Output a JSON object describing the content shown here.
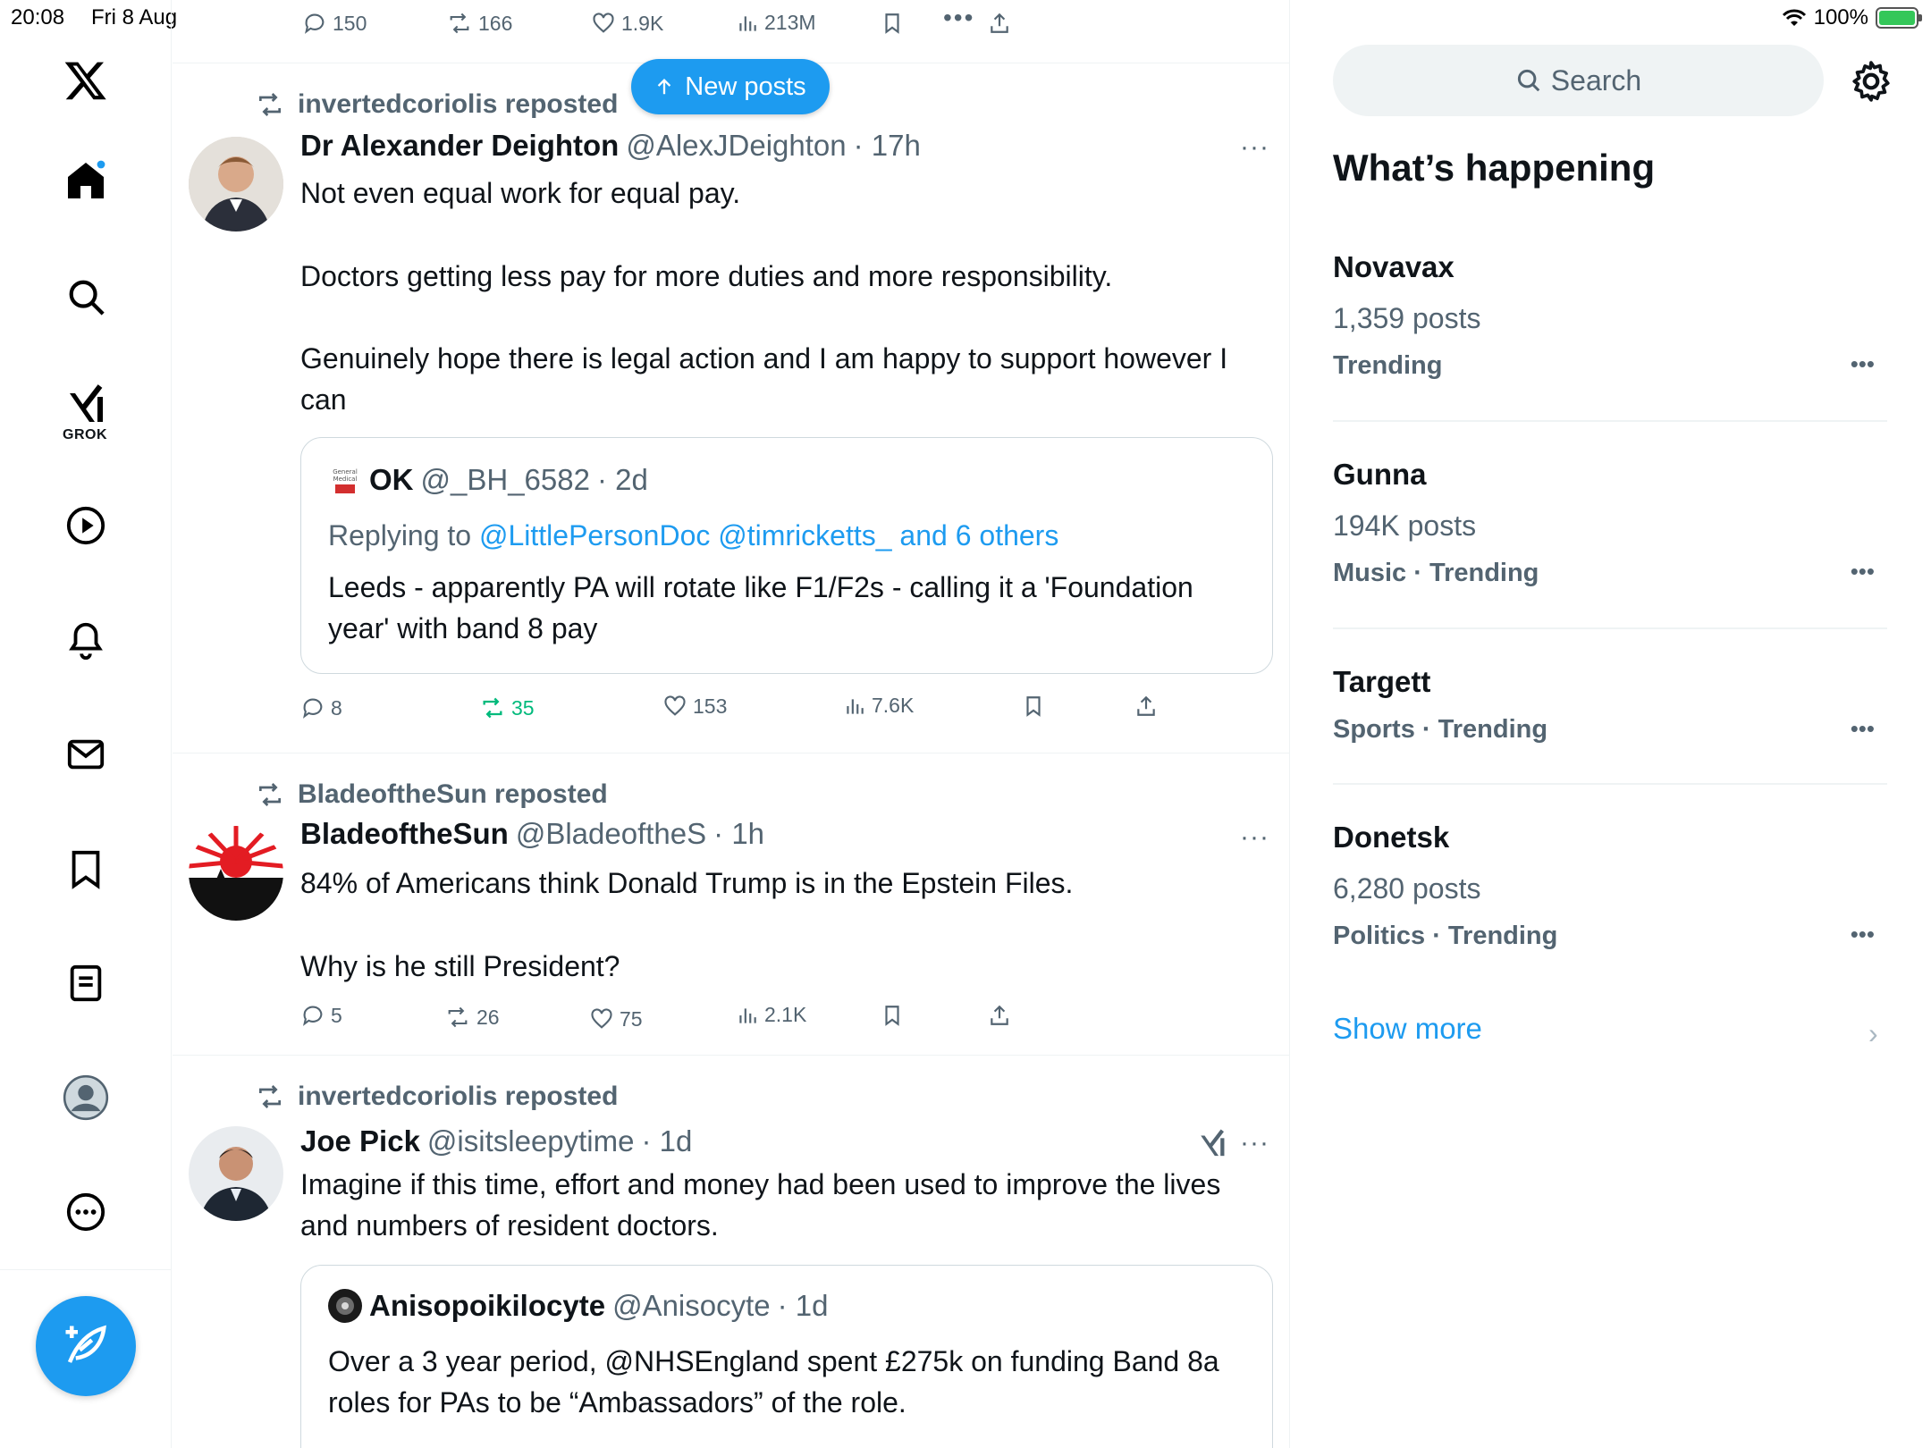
{
  "status_bar": {
    "time": "20:08",
    "date": "Fri 8 Aug",
    "battery": "100%"
  },
  "nav": {
    "grok_label": "GROK"
  },
  "top_actions": {
    "replies": "150",
    "reposts": "166",
    "likes": "1.9K",
    "views": "213M"
  },
  "new_posts_label": "New posts",
  "posts": [
    {
      "reposted_by": "invertedcoriolis reposted",
      "name": "Dr Alexander Deighton",
      "handle": "@AlexJDeighton",
      "time": "· 17h",
      "lines": [
        "Not even equal work for equal pay.",
        "Doctors getting less pay for more duties and more responsibility.",
        "Genuinely hope there is legal action and I am happy to support however I can"
      ],
      "quote": {
        "name": "OK",
        "handle": "@_BH_6582",
        "time": "· 2d",
        "replying_prefix": "Replying to",
        "replying_to": "@LittlePersonDoc @timricketts_ and 6 others",
        "text": "Leeds - apparently PA will rotate like F1/F2s - calling it a 'Foundation year' with band 8 pay"
      },
      "actions": {
        "replies": "8",
        "reposts": "35",
        "likes": "153",
        "views": "7.6K"
      }
    },
    {
      "reposted_by": "BladeoftheSun reposted",
      "name": "BladeoftheSun",
      "handle": "@BladeoftheS",
      "time": "· 1h",
      "lines": [
        "84% of Americans think Donald Trump is in the Epstein Files.",
        "Why is he still President?"
      ],
      "actions": {
        "replies": "5",
        "reposts": "26",
        "likes": "75",
        "views": "2.1K"
      }
    },
    {
      "reposted_by": "invertedcoriolis reposted",
      "name": "Joe Pick",
      "handle": "@isitsleepytime",
      "time": "· 1d",
      "lines": [
        "Imagine if this time, effort and money had been used to improve the lives and numbers of resident doctors."
      ],
      "quote": {
        "name": "Anisopoikilocyte",
        "handle": "@Anisocyte",
        "time": "· 1d",
        "text": "Over a 3 year period, @NHSEngland spent £275k on funding Band 8a roles for PAs to be “Ambassadors” of the role."
      }
    }
  ],
  "right": {
    "search_placeholder": "Search",
    "title": "What’s happening",
    "trends": [
      {
        "name": "Novavax",
        "posts": "1,359 posts",
        "category": "Trending"
      },
      {
        "name": "Gunna",
        "posts": "194K posts",
        "category": "Music · Trending"
      },
      {
        "name": "Targett",
        "posts": "",
        "category": "Sports · Trending"
      },
      {
        "name": "Donetsk",
        "posts": "6,280 posts",
        "category": "Politics · Trending"
      }
    ],
    "show_more": "Show more"
  },
  "colors": {
    "accent": "#1d9bf0",
    "repost_active": "#00ba7c",
    "muted": "#536471"
  }
}
